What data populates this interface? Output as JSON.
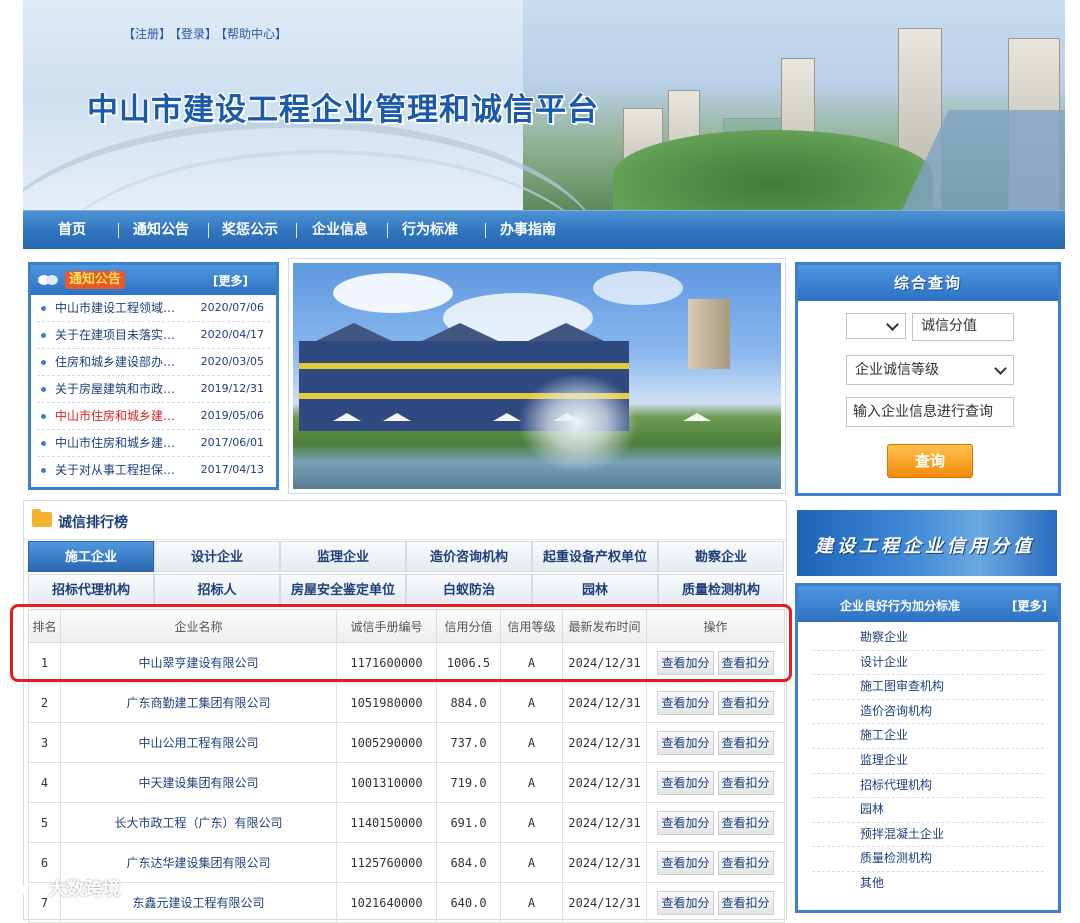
{
  "header": {
    "top_links": [
      "【注册】",
      "【登录】",
      "【帮助中心】"
    ],
    "site_title": "中山市建设工程企业管理和诚信平台"
  },
  "nav": {
    "items": [
      "首页",
      "通知公告",
      "奖惩公示",
      "企业信息",
      "行为标准",
      "办事指南"
    ]
  },
  "notice": {
    "title": "通知公告",
    "more": "[更多]",
    "items": [
      {
        "title": "中山市建设工程领域…",
        "date": "2020/07/06"
      },
      {
        "title": "关于在建项目未落实…",
        "date": "2020/04/17"
      },
      {
        "title": "住房和城乡建设部办…",
        "date": "2020/03/05"
      },
      {
        "title": "关于房屋建筑和市政…",
        "date": "2019/12/31"
      },
      {
        "title": "中山市住房和城乡建…",
        "date": "2019/05/06"
      },
      {
        "title": "中山市住房和城乡建…",
        "date": "2017/06/01"
      },
      {
        "title": "关于对从事工程担保…",
        "date": "2017/04/13"
      }
    ]
  },
  "query": {
    "title": "综合查询",
    "select1_value": "",
    "field_value": "诚信分值",
    "select2_value": "企业诚信等级",
    "search_placeholder": "输入企业信息进行查询",
    "button": "查询"
  },
  "credit_banner": "建设工程企业信用分值",
  "standards": {
    "title": "企业良好行为加分标准",
    "more": "[更多]",
    "items": [
      "勘察企业",
      "设计企业",
      "施工图审查机构",
      "造价咨询机构",
      "施工企业",
      "监理企业",
      "招标代理机构",
      "园林",
      "预拌混凝土企业",
      "质量检测机构",
      "其他"
    ]
  },
  "ranking": {
    "title": "诚信排行榜",
    "tabs_row1": [
      "施工企业",
      "设计企业",
      "监理企业",
      "造价咨询机构",
      "起重设备产权单位",
      "勘察企业"
    ],
    "tabs_row2": [
      "招标代理机构",
      "招标人",
      "房屋安全鉴定单位",
      "白蚁防治",
      "园林",
      "质量检测机构"
    ],
    "active_tab": "施工企业",
    "columns": [
      "排名",
      "企业名称",
      "诚信手册编号",
      "信用分值",
      "信用等级",
      "最新发布时间",
      "操作"
    ],
    "op_add": "查看加分",
    "op_deduct": "查看扣分",
    "rows": [
      {
        "rank": "1",
        "name": "中山翠亨建设有限公司",
        "code": "1171600000",
        "score": "1006.5",
        "grade": "A",
        "date": "2024/12/31"
      },
      {
        "rank": "2",
        "name": "广东商勤建工集团有限公司",
        "code": "1051980000",
        "score": "884.0",
        "grade": "A",
        "date": "2024/12/31"
      },
      {
        "rank": "3",
        "name": "中山公用工程有限公司",
        "code": "1005290000",
        "score": "737.0",
        "grade": "A",
        "date": "2024/12/31"
      },
      {
        "rank": "4",
        "name": "中天建设集团有限公司",
        "code": "1001310000",
        "score": "719.0",
        "grade": "A",
        "date": "2024/12/31"
      },
      {
        "rank": "5",
        "name": "长大市政工程（广东）有限公司",
        "code": "1140150000",
        "score": "691.0",
        "grade": "A",
        "date": "2024/12/31"
      },
      {
        "rank": "6",
        "name": "广东达华建设集团有限公司",
        "code": "1125760000",
        "score": "684.0",
        "grade": "A",
        "date": "2024/12/31"
      },
      {
        "rank": "7",
        "name": "东鑫元建设工程有限公司",
        "code": "1021640000",
        "score": "640.0",
        "grade": "A",
        "date": "2024/12/31"
      }
    ]
  },
  "watermark": "大数跨境"
}
